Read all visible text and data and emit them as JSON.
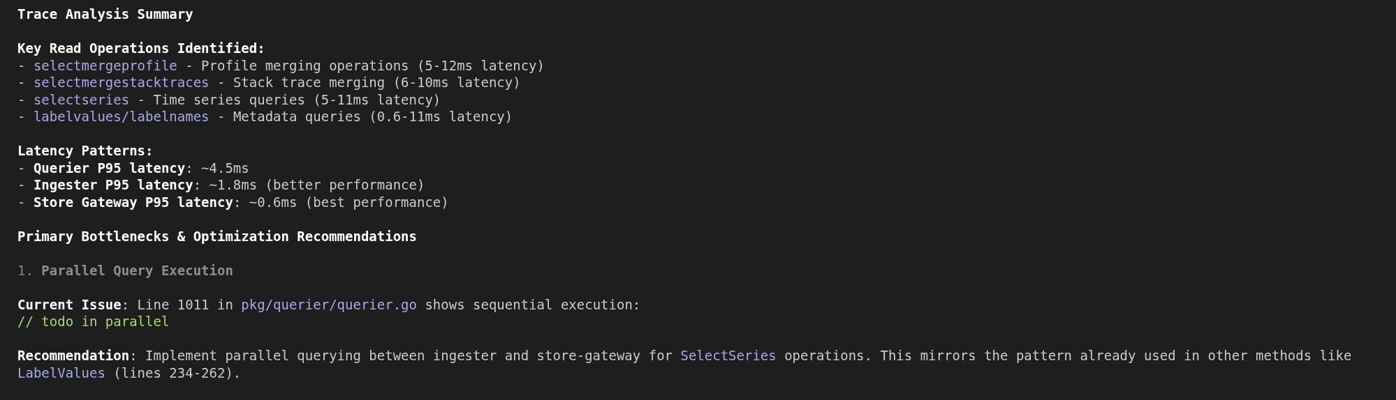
{
  "sections": [
    {
      "lines": [
        {
          "segments": [
            {
              "kind": "bold",
              "text": "Trace Analysis Summary"
            }
          ]
        }
      ]
    },
    {
      "lines": [
        {
          "segments": [
            {
              "kind": "bold",
              "text": "Key Read Operations Identified:"
            }
          ]
        },
        {
          "segments": [
            {
              "kind": "plain",
              "text": "- "
            },
            {
              "kind": "code",
              "text": "selectmergeprofile"
            },
            {
              "kind": "plain",
              "text": " - Profile merging operations (5-12ms latency)"
            }
          ]
        },
        {
          "segments": [
            {
              "kind": "plain",
              "text": "- "
            },
            {
              "kind": "code",
              "text": "selectmergestacktraces"
            },
            {
              "kind": "plain",
              "text": " - Stack trace merging (6-10ms latency)"
            }
          ]
        },
        {
          "segments": [
            {
              "kind": "plain",
              "text": "- "
            },
            {
              "kind": "code",
              "text": "selectseries"
            },
            {
              "kind": "plain",
              "text": " - Time series queries (5-11ms latency)"
            }
          ]
        },
        {
          "segments": [
            {
              "kind": "plain",
              "text": "- "
            },
            {
              "kind": "code",
              "text": "labelvalues/labelnames"
            },
            {
              "kind": "plain",
              "text": " - Metadata queries (0.6-11ms latency)"
            }
          ]
        }
      ]
    },
    {
      "lines": [
        {
          "segments": [
            {
              "kind": "bold",
              "text": "Latency Patterns:"
            }
          ]
        },
        {
          "segments": [
            {
              "kind": "plain",
              "text": "- "
            },
            {
              "kind": "bold",
              "text": "Querier P95 latency"
            },
            {
              "kind": "plain",
              "text": ": ~4.5ms"
            }
          ]
        },
        {
          "segments": [
            {
              "kind": "plain",
              "text": "- "
            },
            {
              "kind": "bold",
              "text": "Ingester P95 latency"
            },
            {
              "kind": "plain",
              "text": ": ~1.8ms (better performance)"
            }
          ]
        },
        {
          "segments": [
            {
              "kind": "plain",
              "text": "- "
            },
            {
              "kind": "bold",
              "text": "Store Gateway P95 latency"
            },
            {
              "kind": "plain",
              "text": ": ~0.6ms (best performance)"
            }
          ]
        }
      ]
    },
    {
      "lines": [
        {
          "segments": [
            {
              "kind": "bold",
              "text": "Primary Bottlenecks & Optimization Recommendations"
            }
          ]
        }
      ]
    },
    {
      "lines": [
        {
          "segments": [
            {
              "kind": "muted",
              "text": "1. "
            },
            {
              "kind": "muted_bold",
              "text": "Parallel Query Execution"
            }
          ]
        }
      ]
    },
    {
      "lines": [
        {
          "segments": [
            {
              "kind": "bold",
              "text": "Current Issue"
            },
            {
              "kind": "plain",
              "text": ": Line 1011 in "
            },
            {
              "kind": "code",
              "text": "pkg/querier/querier.go"
            },
            {
              "kind": "plain",
              "text": " shows sequential execution:"
            }
          ]
        },
        {
          "segments": [
            {
              "kind": "comment",
              "text": "// todo in parallel"
            }
          ]
        }
      ]
    },
    {
      "lines": [
        {
          "segments": [
            {
              "kind": "bold",
              "text": "Recommendation"
            },
            {
              "kind": "plain",
              "text": ": Implement parallel querying between ingester and store-gateway for "
            },
            {
              "kind": "code",
              "text": "SelectSeries"
            },
            {
              "kind": "plain",
              "text": " operations. This mirrors the pattern already used in other methods like "
            },
            {
              "kind": "code",
              "text": "LabelValues"
            },
            {
              "kind": "plain",
              "text": " (lines 234-262)."
            }
          ]
        }
      ]
    }
  ]
}
